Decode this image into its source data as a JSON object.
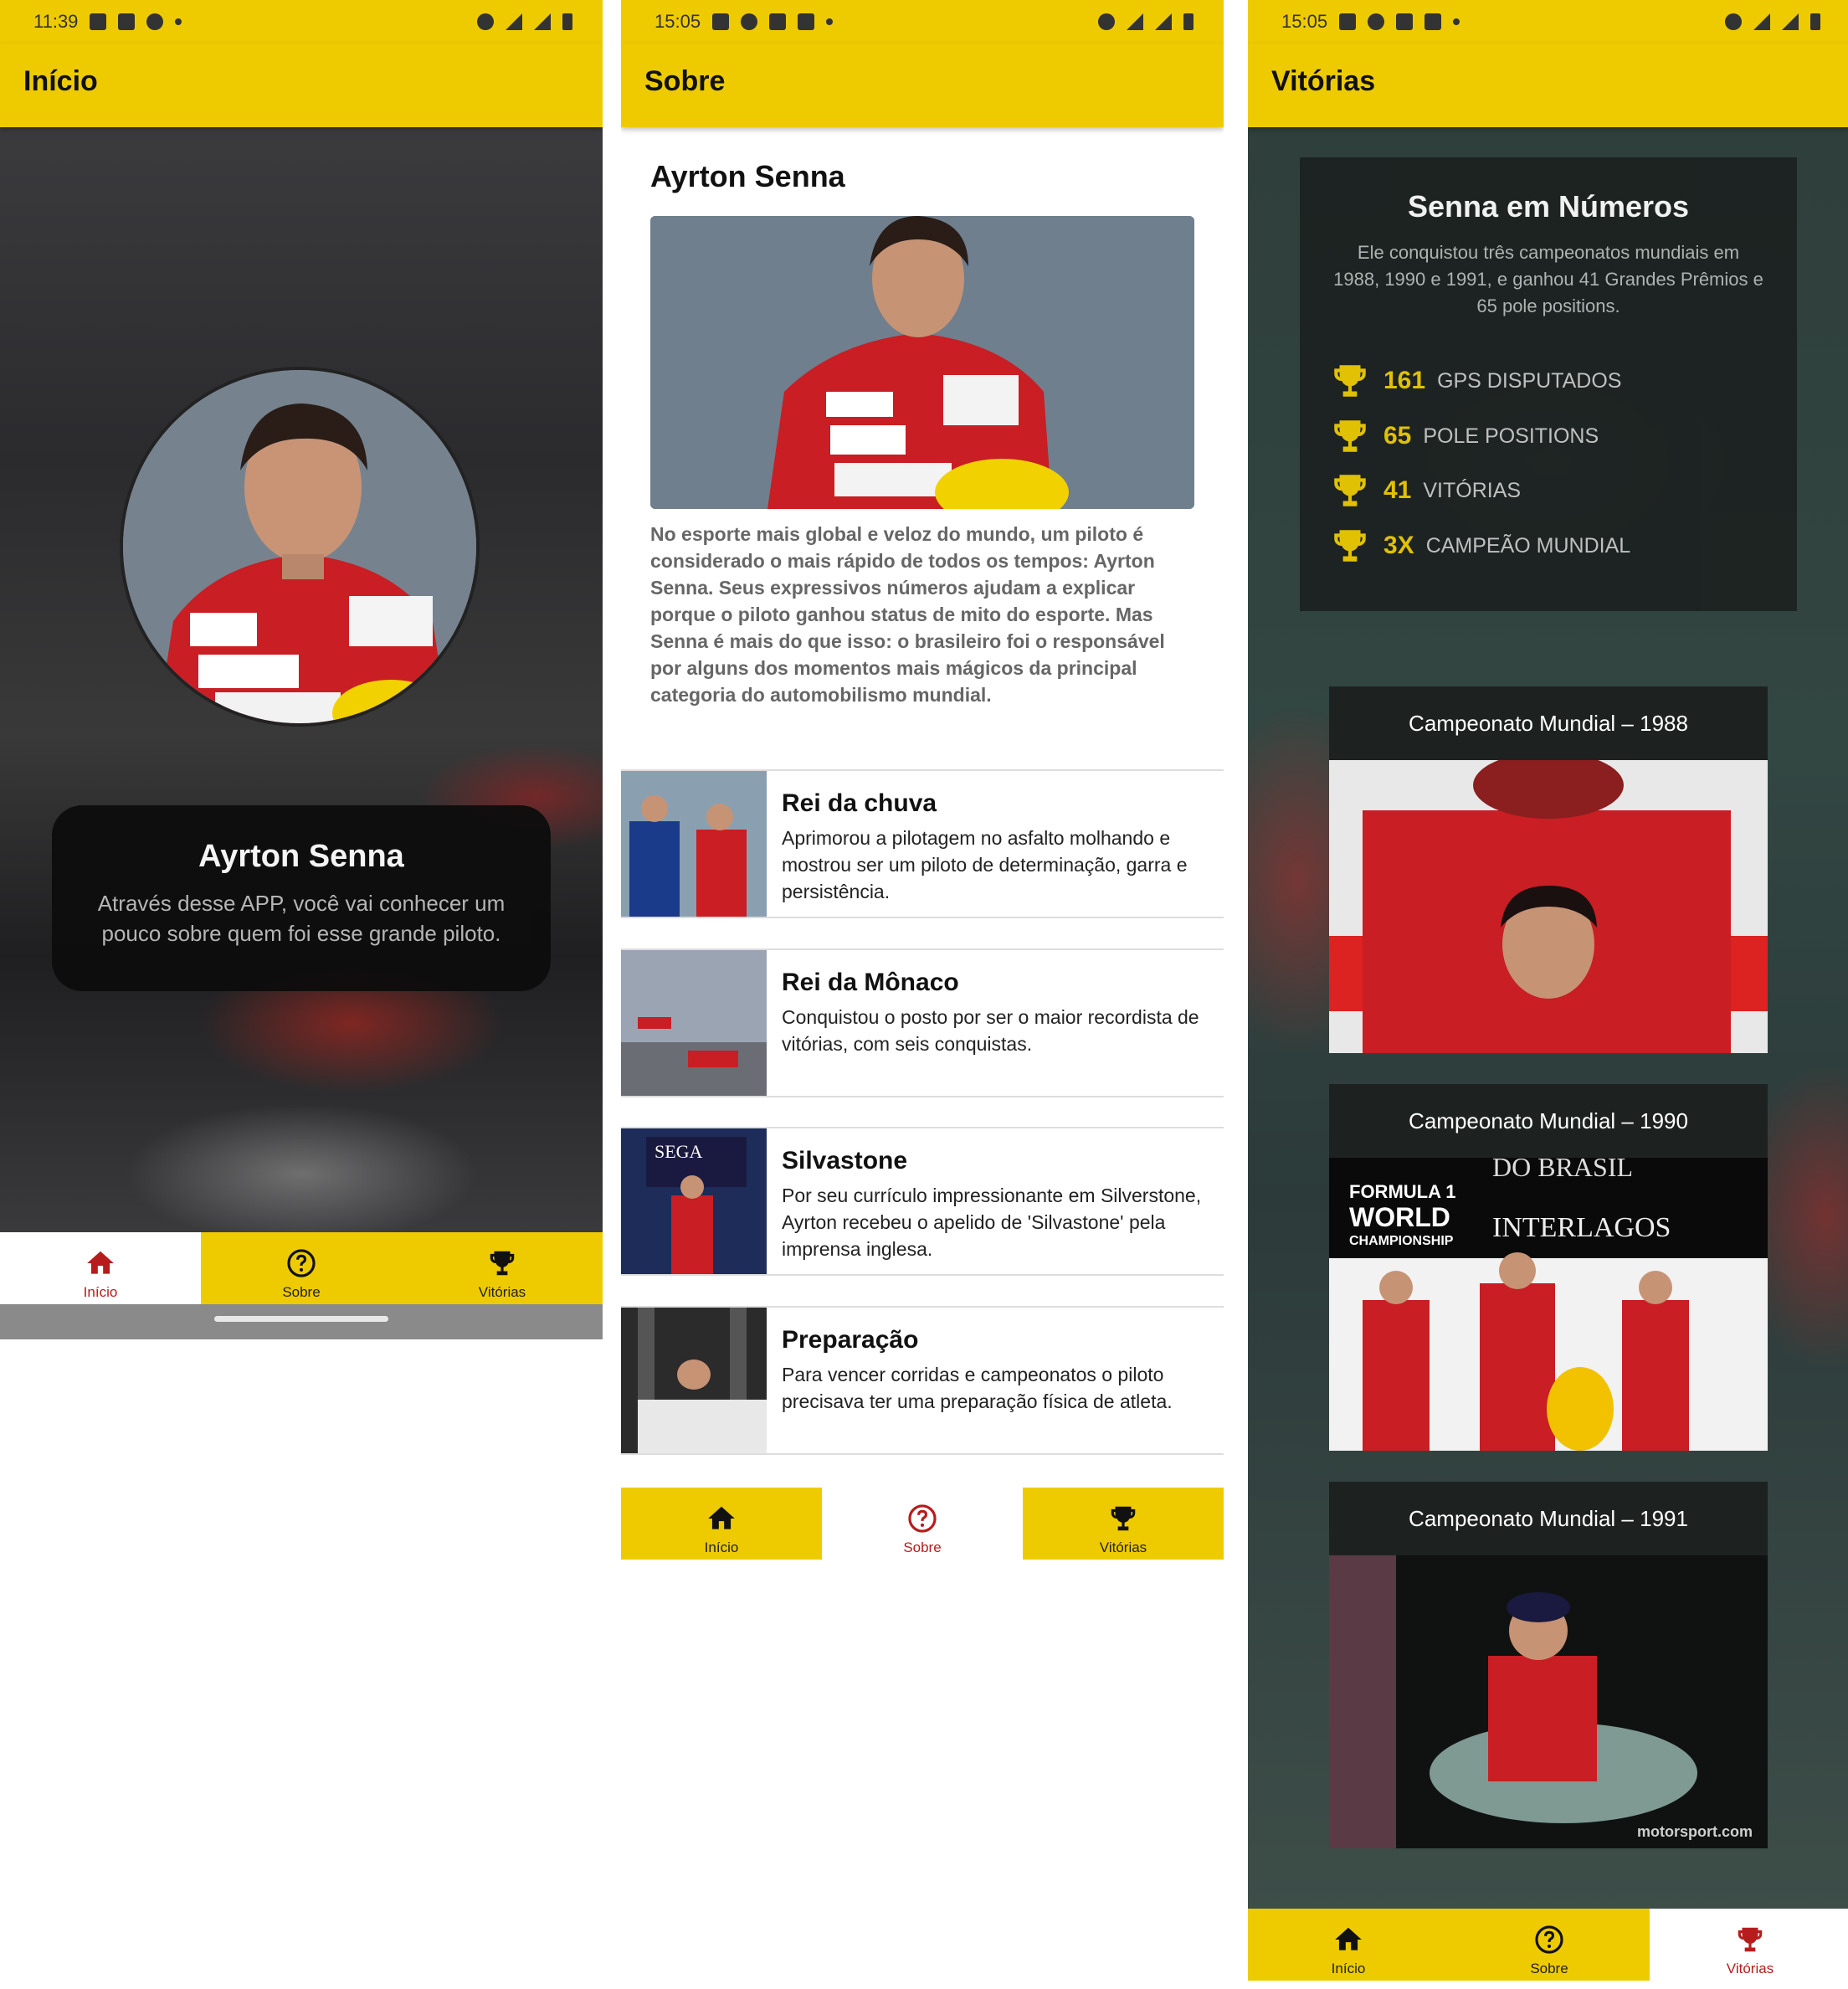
{
  "screens": [
    {
      "status": {
        "time": "11:39"
      },
      "appbar_title": "Início",
      "intro_card": {
        "title": "Ayrton Senna",
        "text": "Através desse APP, você vai conhecer um pouco sobre quem foi esse grande piloto."
      },
      "nav": {
        "active": "inicio"
      }
    },
    {
      "status": {
        "time": "15:05"
      },
      "appbar_title": "Sobre",
      "about": {
        "title": "Ayrton Senna",
        "description": "No esporte mais global e veloz do mundo, um piloto é considerado o mais rápido de todos os tempos: Ayrton Senna. Seus expressivos números ajudam a explicar porque o piloto ganhou status de mito do esporte. Mas Senna é mais do que isso: o brasileiro foi o responsável por alguns dos momentos mais mágicos da principal categoria do automobilismo mundial."
      },
      "moments": [
        {
          "title": "Rei da chuva",
          "text": "Aprimorou a pilotagem no asfalto molhando e mostrou ser um piloto de determinação, garra e persistência."
        },
        {
          "title": "Rei da Mônaco",
          "text": "Conquistou o posto por ser o maior recordista de vitórias, com seis conquistas."
        },
        {
          "title": "Silvastone",
          "text": "Por seu currículo impressionante em Silverstone, Ayrton recebeu o apelido de 'Silvastone' pela imprensa inglesa."
        },
        {
          "title": "Preparação",
          "text": "Para vencer corridas e campeonatos o piloto precisava ter uma preparação física de atleta."
        }
      ],
      "nav": {
        "active": "sobre"
      }
    },
    {
      "status": {
        "time": "15:05"
      },
      "appbar_title": "Vitórias",
      "numbers": {
        "title": "Senna em Números",
        "lead": "Ele conquistou três campeonatos mundiais em 1988, 1990 e 1991, e ganhou 41 Grandes Prêmios e 65 pole positions.",
        "stats": [
          {
            "value": "161",
            "label": "GPS DISPUTADOS"
          },
          {
            "value": "65",
            "label": "POLE POSITIONS"
          },
          {
            "value": "41",
            "label": "VITÓRIAS"
          },
          {
            "value": "3X",
            "label": "CAMPEÃO MUNDIAL"
          }
        ]
      },
      "championships": [
        {
          "title": "Campeonato Mundial – 1988"
        },
        {
          "title": "Campeonato Mundial – 1990"
        },
        {
          "title": "Campeonato Mundial – 1991"
        }
      ],
      "photo_texts": {
        "c1990_line1": "DO BRASIL",
        "c1990_line2": "FORMULA 1",
        "c1990_line3": "WORLD",
        "c1990_line4": "CHAMPIONSHIP",
        "c1990_line5": "INTERLAGOS",
        "c1991_watermark": "motorsport.com",
        "silverstone_banner": "SEGA"
      },
      "nav": {
        "active": "vitorias"
      }
    }
  ],
  "nav_labels": {
    "inicio": "Início",
    "sobre": "Sobre",
    "vitorias": "Vitórias"
  },
  "icons": {
    "home": "home-icon",
    "about": "help-circle-icon",
    "wins": "trophy-icon"
  },
  "colors": {
    "accent": "#eecb00",
    "active": "#b71c1c",
    "dark_card": "#0d0d0d"
  }
}
